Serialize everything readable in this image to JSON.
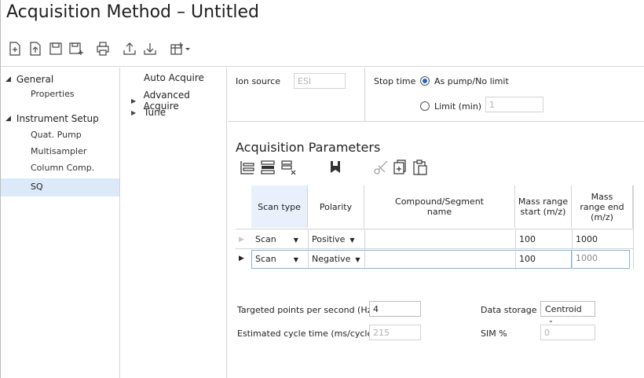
{
  "window": {
    "title": "Acquisition Method – Untitled"
  },
  "toolbar": {
    "icons": [
      "new-method-icon",
      "open-method-icon",
      "save-icon",
      "save-as-icon",
      "print-icon",
      "upload-icon",
      "download-icon",
      "insert-dropdown-icon"
    ]
  },
  "tree": {
    "groups": [
      {
        "label": "General",
        "children": [
          "Properties"
        ]
      },
      {
        "label": "Instrument Setup",
        "children": [
          "Quat. Pump",
          "Multisampler",
          "Column Comp.",
          "SQ"
        ]
      }
    ],
    "selected": "SQ"
  },
  "nav": {
    "items": [
      {
        "label": "Auto Acquire",
        "expandable": false,
        "selected": true
      },
      {
        "label": "Advanced Acquire",
        "expandable": true
      },
      {
        "label": "Tune",
        "expandable": true
      }
    ]
  },
  "source": {
    "ion_source_label": "Ion source",
    "ion_source_value": "ESI",
    "stop_time_label": "Stop time",
    "opt_pump": "As pump/No limit",
    "opt_limit": "Limit (min)",
    "limit_value": "1",
    "selected_option": "As pump/No limit"
  },
  "acq_params": {
    "title": "Acquisition Parameters",
    "toolbar_icons": [
      "add-row-icon",
      "insert-row-icon",
      "delete-row-icon",
      "bookmark-icon",
      "cut-icon",
      "copy-icon",
      "paste-icon"
    ],
    "columns": [
      "Scan type",
      "Polarity",
      "Compound/Segment name",
      "Mass range start (m/z)",
      "Mass range end (m/z)"
    ],
    "rows": [
      {
        "scan_type": "Scan",
        "polarity": "Positive",
        "compound": "",
        "mass_start": "100",
        "mass_end": "1000"
      },
      {
        "scan_type": "Scan",
        "polarity": "Negative",
        "compound": "",
        "mass_start": "100",
        "mass_end": "1000"
      }
    ]
  },
  "settings": {
    "targeted_points_label": "Targeted points per second (Hz)",
    "targeted_points_value": "4",
    "estimated_cycle_label": "Estimated cycle time (ms/cycle)",
    "estimated_cycle_value": "215",
    "data_storage_label": "Data storage",
    "data_storage_value": "Centroid",
    "sim_label": "SIM %",
    "sim_value": "0"
  },
  "colors": {
    "accent": "#1e64c8",
    "selection": "#dbe9f8",
    "row_highlight": "#7fb4e6"
  }
}
